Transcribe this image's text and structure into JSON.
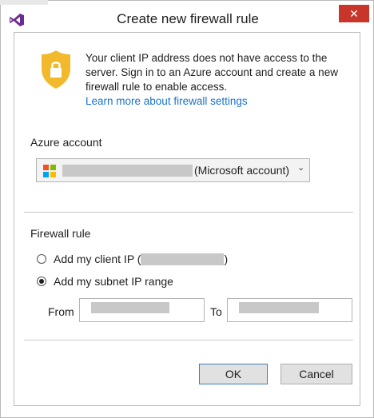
{
  "window": {
    "title": "Create new firewall rule",
    "close_label": "✕"
  },
  "info": {
    "message": "Your client IP address does not have access to the server. Sign in to an Azure account and create a new firewall rule to enable access.",
    "link": "Learn more about firewall settings"
  },
  "azure_account": {
    "label": "Azure account",
    "selected_suffix": "(Microsoft account)"
  },
  "firewall_rule": {
    "label": "Firewall rule",
    "options": [
      {
        "label_prefix": "Add my client IP (",
        "label_suffix": ")",
        "checked": false
      },
      {
        "label": "Add my subnet IP range",
        "checked": true
      }
    ],
    "from_label": "From",
    "to_label": "To"
  },
  "buttons": {
    "ok": "OK",
    "cancel": "Cancel"
  },
  "colors": {
    "link": "#1b74c9",
    "close": "#c7352b",
    "shield": "#f2b92c",
    "vs_purple": "#6a2c91"
  }
}
